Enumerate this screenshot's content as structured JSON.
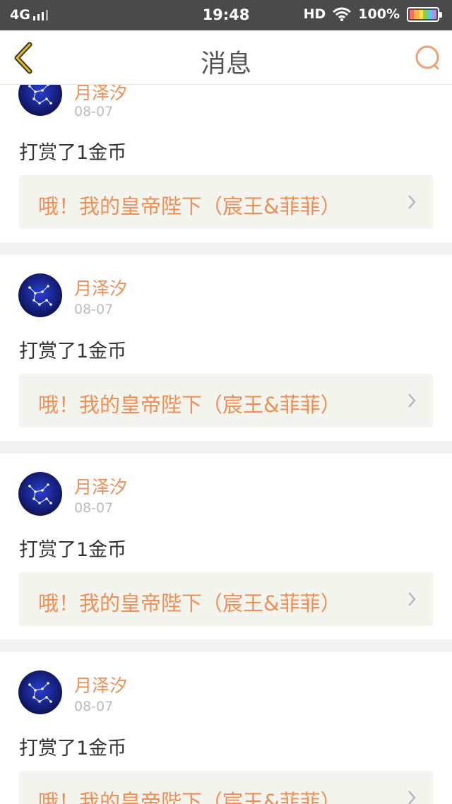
{
  "status_bar": {
    "network": "4G",
    "time": "19:48",
    "hd": "HD",
    "battery": "100%"
  },
  "navbar": {
    "title": "消息",
    "back_icon": "chevron-left-icon",
    "search_icon": "search-icon"
  },
  "colors": {
    "accent": "#ef8e55",
    "back_icon": "#e8c000",
    "link_box_bg": "#f3f4ee"
  },
  "messages": [
    {
      "user": "月泽汐",
      "date": "08-07",
      "action": "打赏了1金币",
      "link": "哦！我的皇帝陛下（宸王&菲菲）"
    },
    {
      "user": "月泽汐",
      "date": "08-07",
      "action": "打赏了1金币",
      "link": "哦！我的皇帝陛下（宸王&菲菲）"
    },
    {
      "user": "月泽汐",
      "date": "08-07",
      "action": "打赏了1金币",
      "link": "哦！我的皇帝陛下（宸王&菲菲）"
    },
    {
      "user": "月泽汐",
      "date": "08-07",
      "action": "打赏了1金币",
      "link": "哦！我的皇帝陛下（宸王&菲菲）"
    }
  ]
}
